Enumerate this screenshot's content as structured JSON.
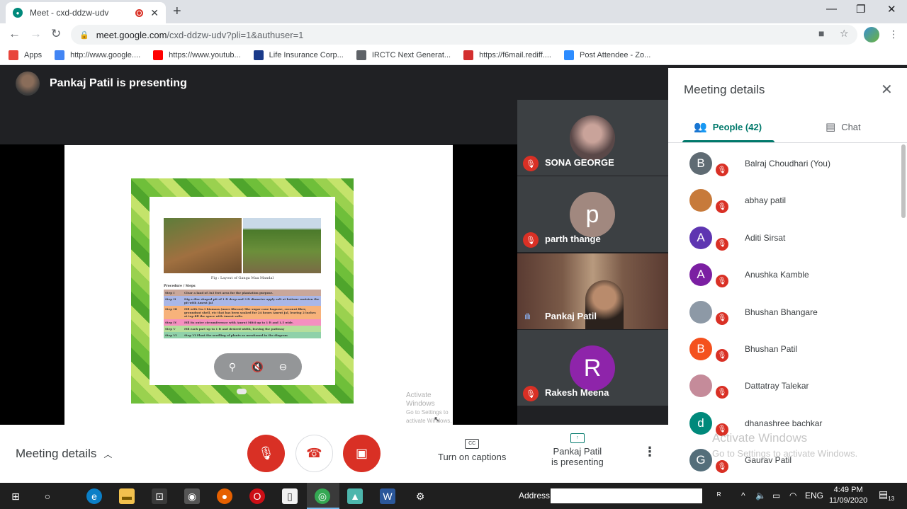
{
  "browser": {
    "tab_title": "Meet - cxd-ddzw-udv",
    "url_host": "meet.google.com",
    "url_rest": "/cxd-ddzw-udv?pli=1&authuser=1"
  },
  "bookmarks": [
    {
      "label": "Apps",
      "icon": "apps-grid-icon",
      "color": "#e8453c"
    },
    {
      "label": "http://www.google....",
      "icon": "google-icon",
      "color": "#4285f4"
    },
    {
      "label": "https://www.youtub...",
      "icon": "youtube-icon",
      "color": "#ff0000"
    },
    {
      "label": "Life Insurance Corp...",
      "icon": "lic-icon",
      "color": "#1a3a8a"
    },
    {
      "label": "IRCTC Next Generat...",
      "icon": "globe-icon",
      "color": "#5f6368"
    },
    {
      "label": "https://f6mail.rediff....",
      "icon": "rediff-icon",
      "color": "#d32f2f"
    },
    {
      "label": "Post Attendee - Zo...",
      "icon": "zoom-icon",
      "color": "#2d8cff"
    }
  ],
  "meet": {
    "presenting_text": "Pankaj Patil is presenting",
    "slide": {
      "caption": "Fig : Layout of Ganga Maa Mandal",
      "procedure": "Procedure / Steps",
      "steps": [
        {
          "label": "Step I",
          "text": "Clear a land of 3x3 feet area for the plantation purpose.",
          "color": "#c9a79a"
        },
        {
          "label": "Step II",
          "text": "Dig a disc shaped pit of 1 ft deep and 3 ft diameter apply salt at bottom- moisten the pit with Amrut Jal",
          "color": "#a9b7e8"
        },
        {
          "label": "Step III",
          "text": "Fill with No.3 biomass (more fibrous) like sugar cane bagasse, coconut fiber, groundnut shell, etc that has been soaked for 24 hours Amrut Jal, leaving 2 inches at top fill the space with Amrut soils.",
          "color": "#f7b27a"
        },
        {
          "label": "Step IV",
          "text": "Fill its outer circumference with Amrut Mitti up to 1 ft and 1.5 wide.",
          "color": "#f58fc0"
        },
        {
          "label": "Step V",
          "text": "Fill each part up to 1 ft and desired width, leaving the pathway",
          "color": "#b5df9c"
        },
        {
          "label": "Step VI",
          "text": "Step VI Plant the seedling of plants as mentioned in the diagram",
          "color": "#8fd1a9"
        }
      ]
    },
    "watermark_small": {
      "line1": "Activate Windows",
      "line2": "Go to Settings to activate Windows."
    },
    "tiles": [
      {
        "name": "SONA GEORGE",
        "initial": "",
        "bg": "#8c6b6b",
        "type": "photo"
      },
      {
        "name": "parth thange",
        "initial": "p",
        "bg": "#a1887f",
        "type": "initial"
      },
      {
        "name": "Pankaj Patil",
        "initial": "",
        "bg": "",
        "type": "video"
      },
      {
        "name": "Rakesh Meena",
        "initial": "R",
        "bg": "#8e24aa",
        "type": "initial"
      }
    ]
  },
  "panel": {
    "title": "Meeting details",
    "people_tab": "People (42)",
    "chat_tab": "Chat",
    "people": [
      {
        "name": "Balraj Choudhari (You)",
        "initial": "B",
        "bg": "#5f6b73"
      },
      {
        "name": "abhay patil",
        "initial": "",
        "bg": "#c77a3a"
      },
      {
        "name": "Aditi Sirsat",
        "initial": "A",
        "bg": "#5e35b1"
      },
      {
        "name": "Anushka Kamble",
        "initial": "A",
        "bg": "#7b1fa2"
      },
      {
        "name": "Bhushan Bhangare",
        "initial": "",
        "bg": "#8d99a6"
      },
      {
        "name": "Bhushan Patil",
        "initial": "B",
        "bg": "#f4511e"
      },
      {
        "name": "Dattatray Talekar",
        "initial": "",
        "bg": "#c58b9a"
      },
      {
        "name": "dhanashree bachkar",
        "initial": "d",
        "bg": "#00897b"
      },
      {
        "name": "Gaurav Patil",
        "initial": "G",
        "bg": "#546e7a"
      }
    ],
    "watermark": {
      "line1": "Activate Windows",
      "line2": "Go to Settings to activate Windows."
    }
  },
  "bottom": {
    "meeting_details": "Meeting details",
    "captions": "Turn on captions",
    "presenting_line1": "Pankaj Patil",
    "presenting_line2": "is presenting"
  },
  "taskbar": {
    "address_label": "Address",
    "lang": "ENG",
    "time": "4:49 PM",
    "date": "11/09/2020",
    "notifications": "13"
  }
}
